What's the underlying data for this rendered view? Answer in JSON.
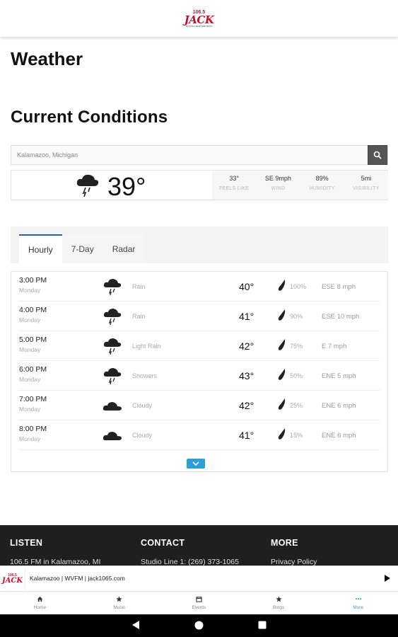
{
  "header": {
    "logo": {
      "number": "106.5",
      "word": "JACK",
      "suffix": "fm",
      "tagline": "PLAYING WHAT WE WANT"
    }
  },
  "page_title": "Weather",
  "section_title": "Current Conditions",
  "search": {
    "value": "Kalamazoo, Michigan",
    "placeholder": "Kalamazoo, Michigan",
    "button_icon": "search-icon"
  },
  "current": {
    "icon": "rain-cloud-icon",
    "temperature": "39°",
    "stats": [
      {
        "value": "33°",
        "label": "FEELS LIKE"
      },
      {
        "value": "SE 9mph",
        "label": "WIND"
      },
      {
        "value": "89%",
        "label": "HUMIDITY"
      },
      {
        "value": "5mi",
        "label": "VISIBILITY"
      }
    ]
  },
  "tabs": [
    {
      "label": "Hourly",
      "active": true
    },
    {
      "label": "7-Day",
      "active": false
    },
    {
      "label": "Radar",
      "active": false
    }
  ],
  "hourly": [
    {
      "time": "3:00 PM",
      "day": "Monday",
      "icon": "rain-cloud-icon",
      "condition": "Rain",
      "temp": "40°",
      "precip": "100%",
      "wind": "ESE 8 mph"
    },
    {
      "time": "4:00 PM",
      "day": "Monday",
      "icon": "rain-cloud-icon",
      "condition": "Rain",
      "temp": "41°",
      "precip": "90%",
      "wind": "ESE 10 mph"
    },
    {
      "time": "5:00 PM",
      "day": "Monday",
      "icon": "rain-cloud-icon",
      "condition": "Light Rain",
      "temp": "42°",
      "precip": "75%",
      "wind": "E 7 mph"
    },
    {
      "time": "6:00 PM",
      "day": "Monday",
      "icon": "rain-cloud-icon",
      "condition": "Showers",
      "temp": "43°",
      "precip": "50%",
      "wind": "ENE 5 mph"
    },
    {
      "time": "7:00 PM",
      "day": "Monday",
      "icon": "cloud-icon",
      "condition": "Cloudy",
      "temp": "42°",
      "precip": "25%",
      "wind": "ENE 6 mph"
    },
    {
      "time": "8:00 PM",
      "day": "Monday",
      "icon": "cloud-icon",
      "condition": "Cloudy",
      "temp": "41°",
      "precip": "15%",
      "wind": "ENE 6 mph"
    }
  ],
  "footer": {
    "columns": [
      {
        "heading": "LISTEN",
        "text": "106.5 FM in Kalamazoo, MI"
      },
      {
        "heading": "CONTACT",
        "text": "Studio Line 1: (269) 373-1065"
      },
      {
        "heading": "MORE",
        "text": "Privacy Policy"
      }
    ]
  },
  "player": {
    "title": "Kalamazoo | WVFM | jack1065.com",
    "logo_word": "JACK",
    "logo_number": "106.5"
  },
  "bottom_nav": [
    {
      "label": "Home",
      "icon": "home-icon",
      "active": false
    },
    {
      "label": "Music",
      "icon": "star-icon",
      "active": false
    },
    {
      "label": "Events",
      "icon": "calendar-icon",
      "active": false
    },
    {
      "label": "Blogs",
      "icon": "star-icon",
      "active": false
    },
    {
      "label": "More",
      "icon": "more-dots-icon",
      "active": true
    }
  ],
  "colors": {
    "accent": "#2a9fd8",
    "brand": "#c8102e",
    "tab_indicator": "#2b5f9e",
    "footer_bg": "#1f1f1f"
  }
}
